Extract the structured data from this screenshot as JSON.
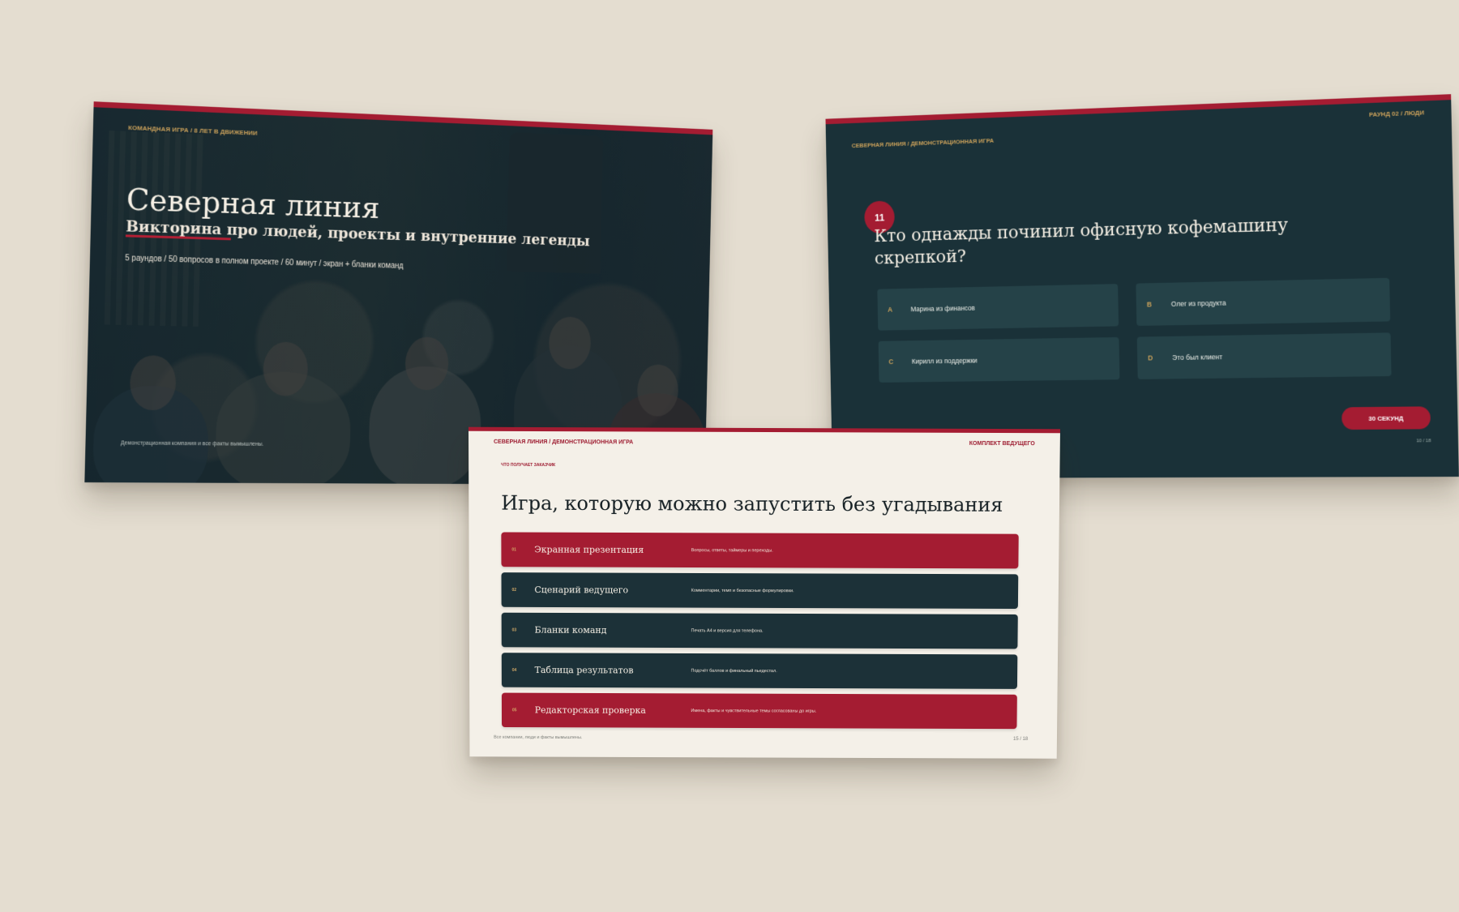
{
  "slides": {
    "title": {
      "kicker": "КОМАНДНАЯ ИГРА / 8 ЛЕТ В ДВИЖЕНИИ",
      "title": "Северная линия",
      "subtitle": "Викторина про людей, проекты и внутренние легенды",
      "meta": "5 раундов / 50 вопросов в полном проекте / 60 минут / экран + бланки команд",
      "disclaimer": "Демонстрационная компания и все факты вымышлены."
    },
    "question": {
      "corner_label": "СЕВЕРНАЯ ЛИНИЯ / ДЕМОНСТРАЦИОННАЯ ИГРА",
      "round_label": "РАУНД 02 / ЛЮДИ",
      "number": "11",
      "text": "Кто однажды починил офисную кофемашину скрепкой?",
      "answers": [
        {
          "letter": "A",
          "text": "Марина из финансов"
        },
        {
          "letter": "B",
          "text": "Олег из продукта"
        },
        {
          "letter": "C",
          "text": "Кирилл из поддержки"
        },
        {
          "letter": "D",
          "text": "Это был клиент"
        }
      ],
      "timer": "30 СЕКУНД",
      "page": "10 / 18"
    },
    "kit": {
      "header_left": "СЕВЕРНАЯ ЛИНИЯ / ДЕМОНСТРАЦИОННАЯ ИГРА",
      "header_right": "КОМПЛЕКТ ВЕДУЩЕГО",
      "kicker": "ЧТО ПОЛУЧАЕТ ЗАКАЗЧИК",
      "title": "Игра, которую можно запустить без угадывания",
      "items": [
        {
          "number": "01",
          "title": "Экранная презентация",
          "description": "Вопросы, ответы, таймеры и переходы."
        },
        {
          "number": "02",
          "title": "Сценарий ведущего",
          "description": "Комментарии, темп и безопасные формулировки."
        },
        {
          "number": "03",
          "title": "Бланки команд",
          "description": "Печать A4 и версия для телефона."
        },
        {
          "number": "04",
          "title": "Таблица результатов",
          "description": "Подсчёт баллов и финальный пьедестал."
        },
        {
          "number": "05",
          "title": "Редакторская проверка",
          "description": "Имена, факты и чувствительные темы согласованы до игры."
        }
      ],
      "footer": "Все компании, люди и факты вымышлены.",
      "page": "15 / 18"
    }
  },
  "colors": {
    "background": "#e4ddd0",
    "dark_slide": "#1a3138",
    "accent_red": "#a41c32",
    "gold": "#c9a05a",
    "paper": "#f4f0e8"
  },
  "icons": {
    "photo": "team-photo",
    "number_badge": "question-number-badge"
  }
}
